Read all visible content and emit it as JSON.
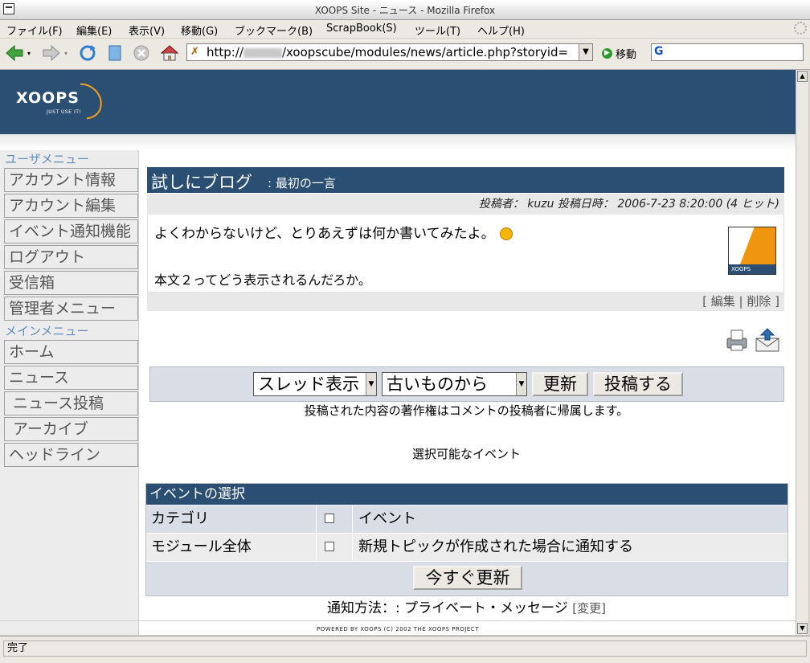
{
  "window": {
    "title": "XOOPS Site - ニュース - Mozilla Firefox"
  },
  "menubar": {
    "items": [
      "ファイル(F)",
      "編集(E)",
      "表示(V)",
      "移動(G)",
      "ブックマーク(B)",
      "ScrapBook(S)",
      "ツール(T)",
      "ヘルプ(H)"
    ]
  },
  "navbar": {
    "url_prefix": "http://",
    "url_suffix": "/xoopscube/modules/news/article.php?storyid=",
    "go_label": "移動",
    "search_engine_icon": "G"
  },
  "header": {
    "logo_text": "XOOPS",
    "logo_tagline": "JUST USE IT!"
  },
  "sidebar": {
    "user_menu_title": "ユーザメニュー",
    "user_menu_items": [
      "アカウント情報",
      "アカウント編集",
      "イベント通知機能",
      "ログアウト",
      "受信箱",
      "管理者メニュー"
    ],
    "main_menu_title": "メインメニュー",
    "main_menu_items": [
      "ホーム",
      "ニュース",
      "ニュース投稿",
      "アーカイブ",
      "ヘッドライン"
    ]
  },
  "story": {
    "topic": "試しにブログ",
    "title": ": 最初の一言",
    "meta": "投稿者： kuzu 投稿日時： 2006-7-23 8:20:00 (4 ヒット)",
    "body_line1": "よくわからないけど、とりあえずは何か書いてみたよ。",
    "body_line2": "本文２ってどう表示されるんだろか。",
    "topic_image_label": "XOOPS",
    "admin_links": "[ 編集 | 削除 ]"
  },
  "comments": {
    "mode_select": "スレッド表示",
    "order_select": "古いものから",
    "refresh_button": "更新",
    "post_button": "投稿する",
    "copyright_notice": "投稿された内容の著作権はコメントの投稿者に帰属します。"
  },
  "notifications": {
    "caption": "選択可能なイベント",
    "table_title": "イベントの選択",
    "rows": [
      {
        "category": "カテゴリ",
        "event": "イベント",
        "checked": false
      },
      {
        "category": "モジュール全体",
        "event": "新規トピックが作成された場合に通知する",
        "checked": false
      }
    ],
    "update_button": "今すぐ更新",
    "method_label": "通知方法：: プライベート・メッセージ",
    "change_link": "[変更]"
  },
  "footer": {
    "powered_by": "POWERED BY XOOPS (C) 2002 THE XOOPS PROJECT"
  },
  "statusbar": {
    "text": "完了"
  },
  "colors": {
    "header_bg": "#2b4f73",
    "menu_title": "#5f8dbd",
    "accent_orange": "#f0960e"
  }
}
